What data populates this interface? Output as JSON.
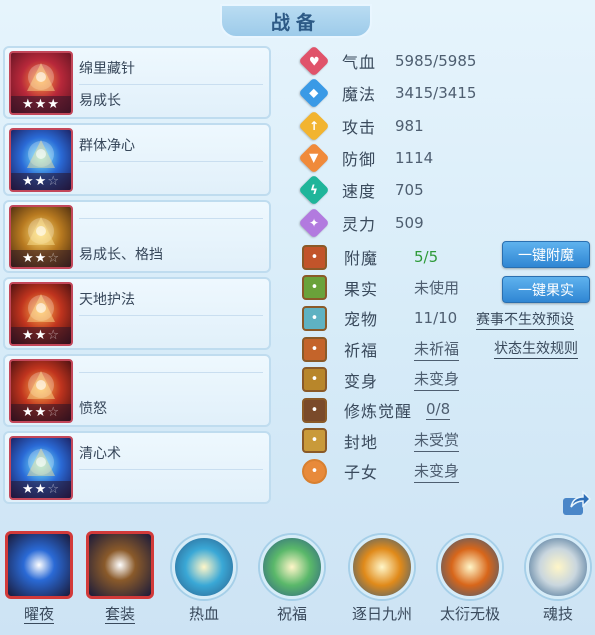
{
  "title": "战备",
  "skills": [
    {
      "name": "绵里藏针",
      "sub": "易成长",
      "stars": 3,
      "total": 3,
      "icon": "needle-sword-icon"
    },
    {
      "name": "群体净心",
      "sub": "",
      "stars": 2,
      "total": 3,
      "icon": "purify-mask-icon"
    },
    {
      "name": "",
      "sub": "易成长、格挡",
      "stars": 2,
      "total": 3,
      "icon": "guardian-warrior-icon"
    },
    {
      "name": "天地护法",
      "sub": "",
      "stars": 2,
      "total": 3,
      "icon": "golden-whip-icon"
    },
    {
      "name": "",
      "sub": "愤怒",
      "stars": 2,
      "total": 3,
      "icon": "flaming-ring-icon"
    },
    {
      "name": "清心术",
      "sub": "",
      "stars": 2,
      "total": 3,
      "icon": "calm-heart-icon"
    }
  ],
  "stats": [
    {
      "label": "气血",
      "value": "5985/5985",
      "color": "#e0536a",
      "icon": "heart-icon",
      "glyph": "♥"
    },
    {
      "label": "魔法",
      "value": "3415/3415",
      "color": "#3a9ae6",
      "icon": "mana-drop-icon",
      "glyph": "◆"
    },
    {
      "label": "攻击",
      "value": "981",
      "color": "#f2b430",
      "icon": "sword-icon",
      "glyph": "↑"
    },
    {
      "label": "防御",
      "value": "1114",
      "color": "#f08a3a",
      "icon": "shield-icon",
      "glyph": "▼"
    },
    {
      "label": "速度",
      "value": "705",
      "color": "#1fb59a",
      "icon": "lightning-icon",
      "glyph": "ϟ"
    },
    {
      "label": "灵力",
      "value": "509",
      "color": "#b27adf",
      "icon": "spirit-icon",
      "glyph": "✦"
    }
  ],
  "extras": [
    {
      "label": "附魔",
      "value": "5/5",
      "style": "green",
      "icon": "enchant-icon",
      "bg": "#c2542a"
    },
    {
      "label": "果实",
      "value": "未使用",
      "style": "",
      "icon": "fruit-icon",
      "bg": "#6aa23a"
    },
    {
      "label": "宠物",
      "value": "11/10",
      "style": "",
      "icon": "pet-avatar-icon",
      "bg": "#5fb2c2"
    },
    {
      "label": "祈福",
      "value": "未祈福",
      "style": "ul",
      "icon": "blessing-icon",
      "bg": "#c4642a"
    },
    {
      "label": "变身",
      "value": "未变身",
      "style": "ul",
      "icon": "transform-icon",
      "bg": "#b8862a"
    },
    {
      "label": "修炼觉醒",
      "value": "0/8",
      "style": "ul",
      "icon": "cultivation-icon",
      "bg": "#7a4a2a"
    },
    {
      "label": "封地",
      "value": "未受赏",
      "style": "ul",
      "icon": "fief-icon",
      "bg": "#c99a3a"
    },
    {
      "label": "子女",
      "value": "未变身",
      "style": "ul",
      "icon": "children-icon",
      "bg": "#e88a3a"
    }
  ],
  "buttons": {
    "enchant_all": "一键附魔",
    "fruit_all": "一键果实"
  },
  "links": {
    "event_preset": "赛事不生效预设",
    "status_rules": "状态生效规则"
  },
  "bottom": [
    {
      "label": "曜夜",
      "shape": "square",
      "underline": true,
      "icon": "night-orb-icon",
      "color": "#2a6ad6"
    },
    {
      "label": "套装",
      "shape": "square",
      "underline": true,
      "icon": "treasure-chest-icon",
      "color": "#8a5a2a"
    },
    {
      "label": "热血",
      "shape": "circle",
      "underline": false,
      "icon": "hot-blood-icon",
      "color": "#3aa8d6"
    },
    {
      "label": "祝福",
      "shape": "circle",
      "underline": false,
      "icon": "blessing-leaf-icon",
      "color": "#5ab86a"
    },
    {
      "label": "逐日九州",
      "shape": "circle",
      "underline": false,
      "icon": "sun-chase-icon",
      "color": "#e08a1a"
    },
    {
      "label": "太衍无极",
      "shape": "circle",
      "underline": false,
      "icon": "taiyan-drum-icon",
      "color": "#d8661a"
    },
    {
      "label": "魂技",
      "shape": "circle",
      "underline": false,
      "icon": "soul-skill-icon",
      "color": "#c9d6de"
    }
  ]
}
